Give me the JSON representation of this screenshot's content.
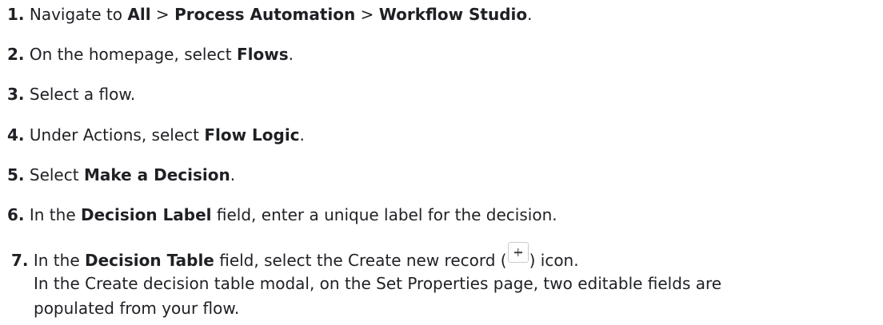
{
  "steps": [
    {
      "num": "1.",
      "parts": [
        {
          "t": " Navigate to "
        },
        {
          "b": "All"
        },
        {
          "t": " > "
        },
        {
          "b": "Process Automation"
        },
        {
          "t": " > "
        },
        {
          "b": "Workflow Studio"
        },
        {
          "t": "."
        }
      ]
    },
    {
      "num": "2.",
      "parts": [
        {
          "t": " On the homepage, select "
        },
        {
          "b": "Flows"
        },
        {
          "t": "."
        }
      ]
    },
    {
      "num": "3.",
      "parts": [
        {
          "t": " Select a flow."
        }
      ]
    },
    {
      "num": "4.",
      "parts": [
        {
          "t": " Under Actions, select "
        },
        {
          "b": "Flow Logic"
        },
        {
          "t": "."
        }
      ]
    },
    {
      "num": "5.",
      "parts": [
        {
          "t": " Select "
        },
        {
          "b": "Make a Decision"
        },
        {
          "t": "."
        }
      ]
    },
    {
      "num": "6.",
      "parts": [
        {
          "t": " In the "
        },
        {
          "b": "Decision Label"
        },
        {
          "t": " field, enter a unique label for the decision."
        }
      ]
    },
    {
      "num": "7.",
      "parts": [
        {
          "t": " In the "
        },
        {
          "b": "Decision Table"
        },
        {
          "t": " field, select the Create new record ("
        },
        {
          "icon": "plus-icon"
        },
        {
          "t": ") icon."
        }
      ],
      "continuation": [
        "In the Create decision table modal, on the Set Properties page, two editable fields are",
        "populated from your flow."
      ]
    }
  ]
}
